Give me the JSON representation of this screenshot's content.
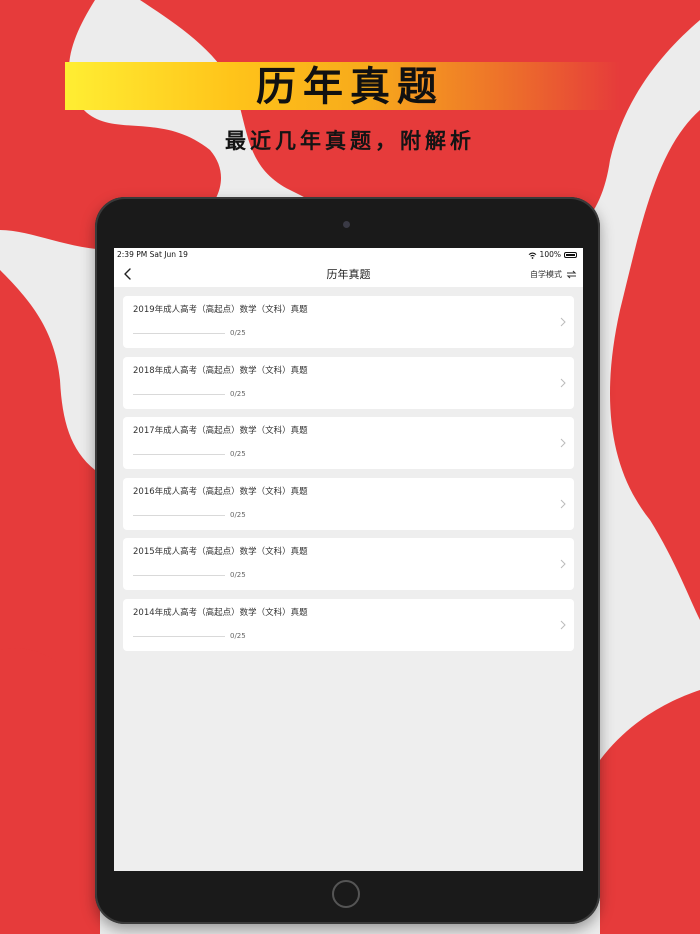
{
  "promo": {
    "headline": "历年真题",
    "subline": "最近几年真题，附解析"
  },
  "status_bar": {
    "time": "2:39 PM  Sat Jun 19",
    "battery": "100%"
  },
  "nav": {
    "title": "历年真题",
    "mode_label": "自学模式"
  },
  "exams": [
    {
      "title": "2019年成人高考（高起点）数学（文科）真题",
      "progress": "0/25"
    },
    {
      "title": "2018年成人高考（高起点）数学（文科）真题",
      "progress": "0/25"
    },
    {
      "title": "2017年成人高考（高起点）数学（文科）真题",
      "progress": "0/25"
    },
    {
      "title": "2016年成人高考（高起点）数学（文科）真题",
      "progress": "0/25"
    },
    {
      "title": "2015年成人高考（高起点）数学（文科）真题",
      "progress": "0/25"
    },
    {
      "title": "2014年成人高考（高起点）数学（文科）真题",
      "progress": "0/25"
    }
  ],
  "colors": {
    "brand_red": "#e63b3b",
    "banner_yellow": "#ffee33",
    "banner_orange": "#ec6a2c"
  },
  "icons": {
    "back": "back-icon",
    "swap": "swap-icon",
    "chevron": "chevron-right-icon",
    "wifi": "wifi-icon",
    "battery": "battery-icon"
  }
}
